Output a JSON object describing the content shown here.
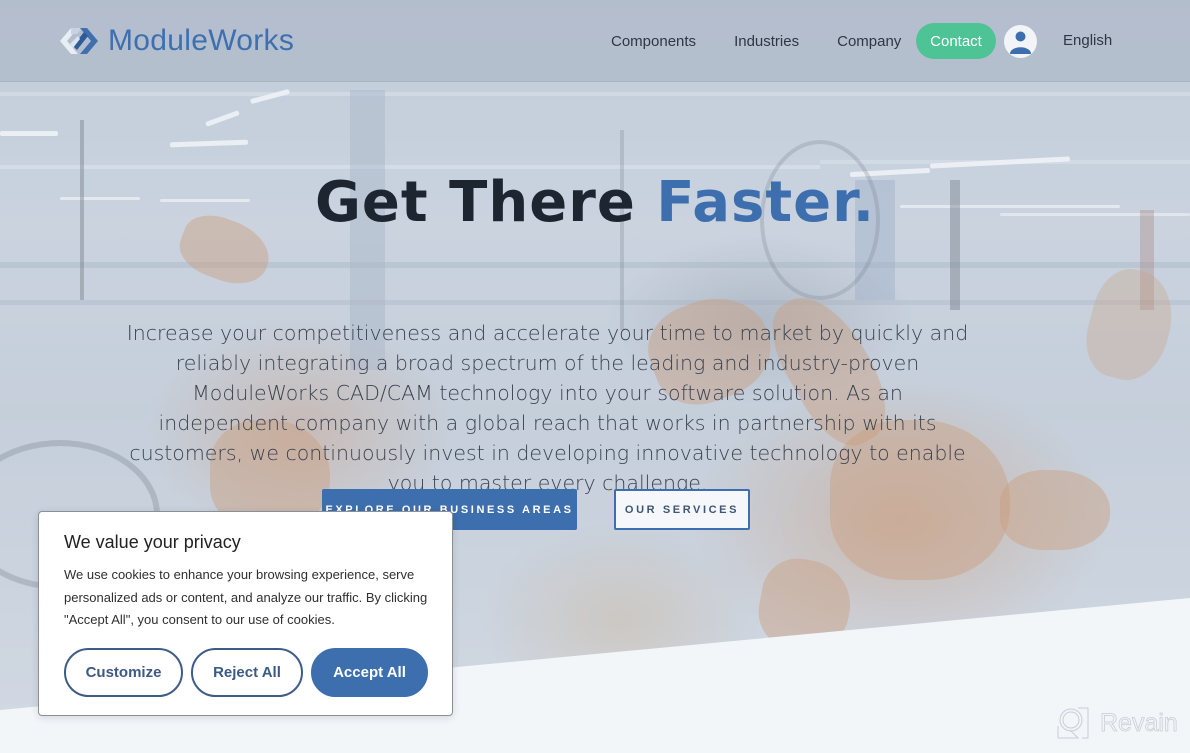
{
  "header": {
    "logo_text": "ModuleWorks",
    "nav": [
      {
        "label": "Components"
      },
      {
        "label": "Industries"
      },
      {
        "label": "Company"
      }
    ],
    "contact_label": "Contact",
    "user_icon": "user-avatar-icon",
    "language_label": "English"
  },
  "hero": {
    "title_main": "Get There ",
    "title_accent": "Faster.",
    "description": "Increase your competitiveness and accelerate your time to market by quickly and reliably integrating a broad spectrum of the leading and industry-proven ModuleWorks CAD/CAM technology into your software solution. As an independent company with a global reach that works in partnership with its customers, we continuously invest in developing innovative technology to enable you to master every challenge.",
    "primary_button": "EXPLORE OUR BUSINESS AREAS",
    "secondary_button": "OUR SERVICES"
  },
  "cookie_banner": {
    "title": "We value your privacy",
    "text": "We use cookies to enhance your browsing experience, serve personalized ads or content, and analyze our traffic. By clicking \"Accept All\", you consent to our use of cookies.",
    "customize_label": "Customize",
    "reject_label": "Reject All",
    "accept_label": "Accept All"
  },
  "watermark": {
    "text": "Revain"
  },
  "colors": {
    "brand_blue": "#3d6eae",
    "contact_green": "#4ec396",
    "title_dark": "#1d2530"
  }
}
